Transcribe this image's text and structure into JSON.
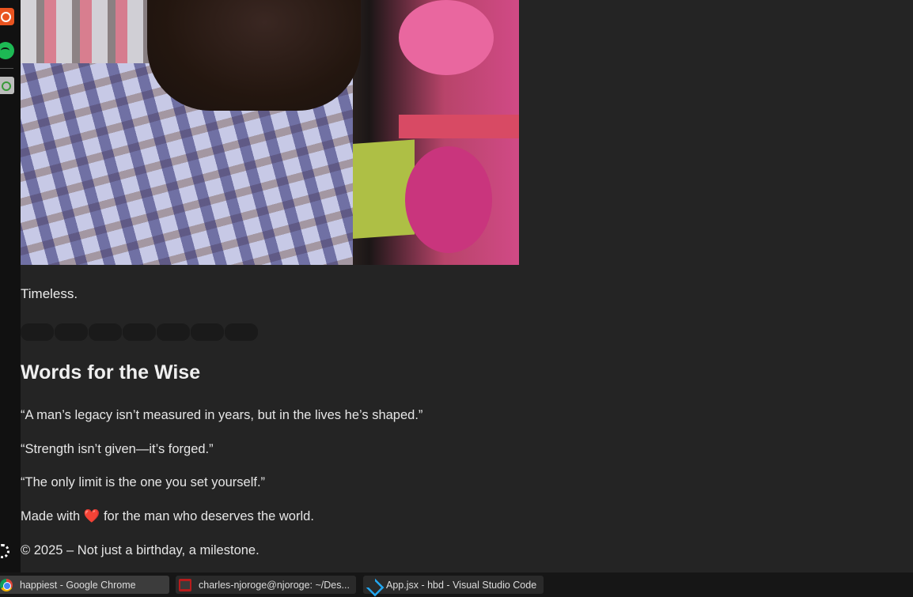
{
  "page": {
    "caption": "Timeless.",
    "pills_count": 7,
    "section_heading": "Words for the Wise",
    "quotes": [
      "“A man’s legacy isn’t measured in years, but in the lives he’s shaped.”",
      "“Strength isn’t given—it’s forged.”",
      "“The only limit is the one you set yourself.”"
    ],
    "footer": {
      "made_prefix": "Made with",
      "heart": "❤️",
      "made_suffix": "for the man who deserves the world.",
      "copyright": "© 2025 – Not just a birthday, a milestone."
    }
  },
  "dock": {
    "icons": [
      "ubuntu-icon",
      "spotify-icon",
      "trash-icon",
      "show-apps-icon"
    ]
  },
  "taskbar": {
    "items": [
      {
        "label": "happiest - Google Chrome",
        "icon": "chrome-icon",
        "active": true
      },
      {
        "label": "charles-njoroge@njoroge: ~/Des...",
        "icon": "terminal-icon",
        "active": false
      },
      {
        "label": "App.jsx - hbd - Visual Studio Code",
        "icon": "vscode-icon",
        "active": false
      }
    ]
  }
}
